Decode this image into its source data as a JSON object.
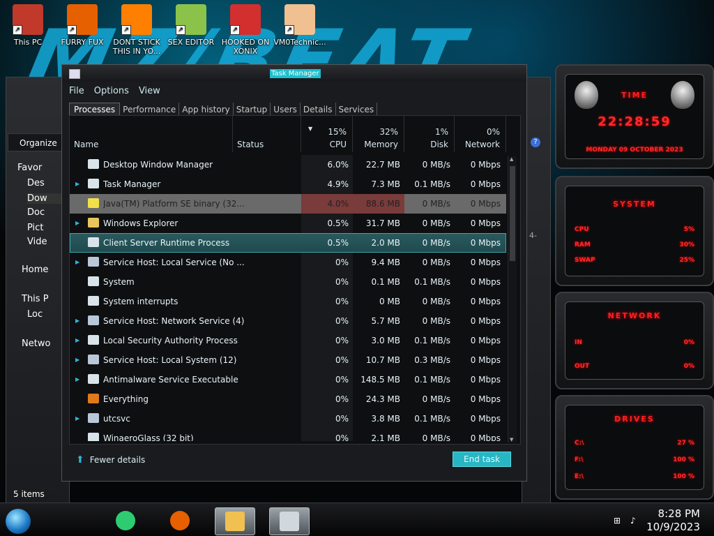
{
  "desktop": {
    "wallpaper_text": "M7/BEAT",
    "icons": [
      {
        "label": "This PC",
        "color": "#c0392b"
      },
      {
        "label": "FURRY FUX",
        "color": "#e66000"
      },
      {
        "label": "DONT STICK THIS IN YO...",
        "color": "#ff7f00"
      },
      {
        "label": "SEX EDITOR",
        "color": "#8bc34a"
      },
      {
        "label": "HOOKED ON XONIX",
        "color": "#d32f2f"
      },
      {
        "label": "VM0Technic...",
        "color": "#f0c090"
      }
    ]
  },
  "explorer": {
    "organize": "Organize",
    "nav": [
      "Favor",
      "Des",
      "Dow",
      "Doc",
      "Pict",
      "Vide",
      "Home",
      "This P",
      "Loc",
      "Netwo"
    ],
    "status": "5 items",
    "partial_text": "4-"
  },
  "task_manager": {
    "title": "Task Manager",
    "menu": [
      "File",
      "Options",
      "View"
    ],
    "tabs": [
      "Processes",
      "Performance",
      "App history",
      "Startup",
      "Users",
      "Details",
      "Services"
    ],
    "columns": {
      "name": "Name",
      "status": "Status",
      "cpu": {
        "pct": "15%",
        "label": "CPU"
      },
      "memory": {
        "pct": "32%",
        "label": "Memory"
      },
      "disk": {
        "pct": "1%",
        "label": "Disk"
      },
      "network": {
        "pct": "0%",
        "label": "Network"
      }
    },
    "processes": [
      {
        "name": "Desktop Window Manager",
        "expandable": false,
        "icon_color": "#d8e4ea",
        "cpu": "6.0%",
        "memory": "22.7 MB",
        "disk": "0 MB/s",
        "network": "0 Mbps"
      },
      {
        "name": "Task Manager",
        "expandable": true,
        "icon_color": "#d8e4ea",
        "cpu": "4.9%",
        "memory": "7.3 MB",
        "disk": "0.1 MB/s",
        "network": "0 Mbps"
      },
      {
        "name": "Java(TM) Platform SE binary (32...",
        "expandable": false,
        "icon_color": "#f2e04a",
        "cpu": "4.0%",
        "memory": "88.6 MB",
        "disk": "0 MB/s",
        "network": "0 Mbps"
      },
      {
        "name": "Windows Explorer",
        "expandable": true,
        "icon_color": "#e8c55a",
        "cpu": "0.5%",
        "memory": "31.7 MB",
        "disk": "0 MB/s",
        "network": "0 Mbps"
      },
      {
        "name": "Client Server Runtime Process",
        "expandable": false,
        "icon_color": "#d8e4ea",
        "cpu": "0.5%",
        "memory": "2.0 MB",
        "disk": "0 MB/s",
        "network": "0 Mbps"
      },
      {
        "name": "Service Host: Local Service (No ...",
        "expandable": true,
        "icon_color": "#b8c8d8",
        "cpu": "0%",
        "memory": "9.4 MB",
        "disk": "0 MB/s",
        "network": "0 Mbps"
      },
      {
        "name": "System",
        "expandable": false,
        "icon_color": "#d8e4ea",
        "cpu": "0%",
        "memory": "0.1 MB",
        "disk": "0.1 MB/s",
        "network": "0 Mbps"
      },
      {
        "name": "System interrupts",
        "expandable": false,
        "icon_color": "#d8e4ea",
        "cpu": "0%",
        "memory": "0 MB",
        "disk": "0 MB/s",
        "network": "0 Mbps"
      },
      {
        "name": "Service Host: Network Service (4)",
        "expandable": true,
        "icon_color": "#b8c8d8",
        "cpu": "0%",
        "memory": "5.7 MB",
        "disk": "0 MB/s",
        "network": "0 Mbps"
      },
      {
        "name": "Local Security Authority Process",
        "expandable": true,
        "icon_color": "#d8e4ea",
        "cpu": "0%",
        "memory": "3.0 MB",
        "disk": "0.1 MB/s",
        "network": "0 Mbps"
      },
      {
        "name": "Service Host: Local System (12)",
        "expandable": true,
        "icon_color": "#b8c8d8",
        "cpu": "0%",
        "memory": "10.7 MB",
        "disk": "0.3 MB/s",
        "network": "0 Mbps"
      },
      {
        "name": "Antimalware Service Executable",
        "expandable": true,
        "icon_color": "#d8e4ea",
        "cpu": "0%",
        "memory": "148.5 MB",
        "disk": "0.1 MB/s",
        "network": "0 Mbps"
      },
      {
        "name": "Everything",
        "expandable": false,
        "icon_color": "#e07a1a",
        "cpu": "0%",
        "memory": "24.3 MB",
        "disk": "0 MB/s",
        "network": "0 Mbps"
      },
      {
        "name": "utcsvc",
        "expandable": true,
        "icon_color": "#b8c8d8",
        "cpu": "0%",
        "memory": "3.8 MB",
        "disk": "0.1 MB/s",
        "network": "0 Mbps"
      },
      {
        "name": "WinaeroGlass (32 bit)",
        "expandable": false,
        "icon_color": "#d8e4ea",
        "cpu": "0%",
        "memory": "2.1 MB",
        "disk": "0 MB/s",
        "network": "0 Mbps"
      }
    ],
    "fewer_details": "Fewer details",
    "end_task": "End task"
  },
  "gadgets": {
    "time": {
      "title": "TIME",
      "clock": "22:28:59",
      "date": "MONDAY 09 OCTOBER 2023"
    },
    "system": {
      "title": "SYSTEM",
      "rows": [
        {
          "label": "CPU",
          "value": "5%"
        },
        {
          "label": "RAM",
          "value": "30%"
        },
        {
          "label": "SWAP",
          "value": "25%"
        }
      ]
    },
    "network": {
      "title": "NETWORK",
      "rows": [
        {
          "label": "IN",
          "value": "0%"
        },
        {
          "label": "OUT",
          "value": "0%"
        }
      ]
    },
    "drives": {
      "title": "DRIVES",
      "rows": [
        {
          "label": "C:\\",
          "value": "27 %"
        },
        {
          "label": "F:\\",
          "value": "100 %"
        },
        {
          "label": "E:\\",
          "value": "100 %"
        }
      ]
    }
  },
  "taskbar": {
    "time": "8:28 PM",
    "date": "10/9/2023",
    "apps": [
      {
        "name": "app-green",
        "color": "#2ecc71"
      },
      {
        "name": "firefox",
        "color": "#e66000"
      },
      {
        "name": "file-explorer",
        "color": "#f0c050"
      },
      {
        "name": "task-manager",
        "color": "#cfd8dc"
      }
    ]
  },
  "colors": {
    "accent": "#1ec0cf",
    "gadget_red": "#ff2020"
  }
}
